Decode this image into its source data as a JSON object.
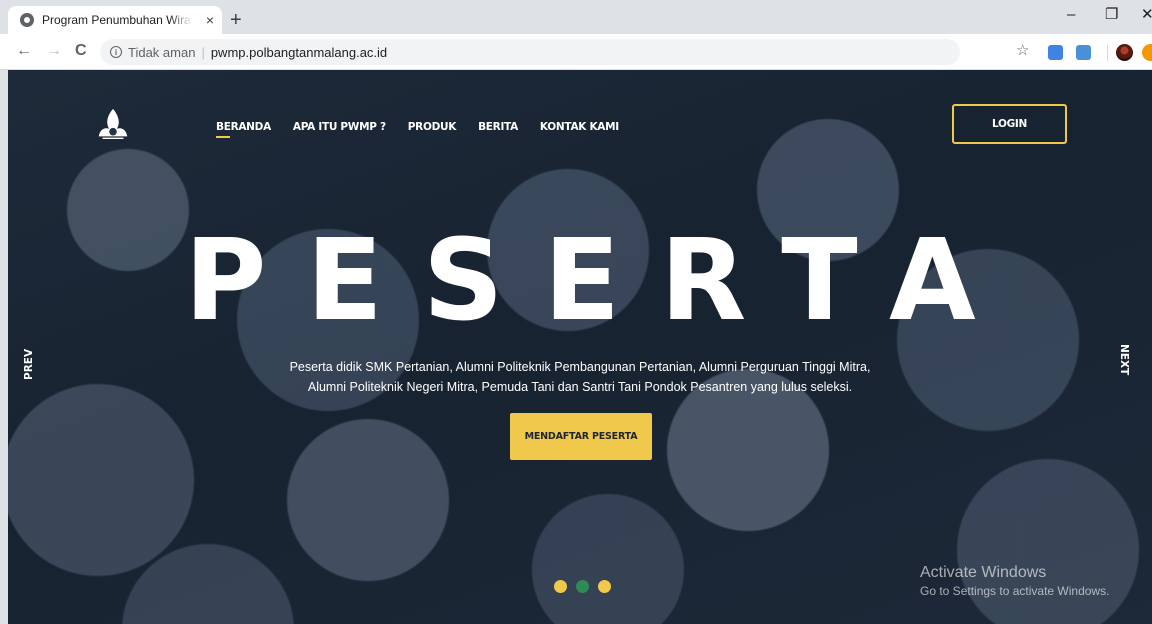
{
  "browser": {
    "tab_title": "Program Penumbuhan Wirausaha",
    "tab_close": "×",
    "new_tab": "+",
    "back": "←",
    "forward": "→",
    "reload": "C",
    "security_text": "Tidak aman",
    "url": "pwmp.polbangtanmalang.ac.id",
    "window_controls": {
      "minimize": "–",
      "maximize": "❐",
      "close": "✕"
    }
  },
  "nav": {
    "items": [
      {
        "label": "BERANDA"
      },
      {
        "label": "APA ITU PWMP ?"
      },
      {
        "label": "PRODUK"
      },
      {
        "label": "BERITA"
      },
      {
        "label": "KONTAK KAMI"
      }
    ],
    "login_label": "LOGIN"
  },
  "hero": {
    "title": "PESERTA",
    "description_line1": "Peserta didik SMK Pertanian, Alumni Politeknik Pembangunan Pertanian, Alumni Perguruan Tinggi Mitra,",
    "description_line2": "Alumni Politeknik Negeri Mitra, Pemuda Tani dan Santri Tani Pondok Pesantren yang lulus seleksi.",
    "cta_label": "MENDAFTAR PESERTA",
    "prev_label": "PREV",
    "next_label": "NEXT"
  },
  "carousel": {
    "active_index": 1,
    "dot_colors": [
      "#f0c84b",
      "#2e8b57",
      "#f0c84b"
    ]
  },
  "watermark": {
    "title": "Activate Windows",
    "subtitle": "Go to Settings to activate Windows."
  },
  "colors": {
    "accent": "#f0c84b"
  },
  "icons": [
    "globe-icon",
    "info-icon",
    "star-icon",
    "extension-icon",
    "avatar-icon",
    "logo-icon"
  ]
}
